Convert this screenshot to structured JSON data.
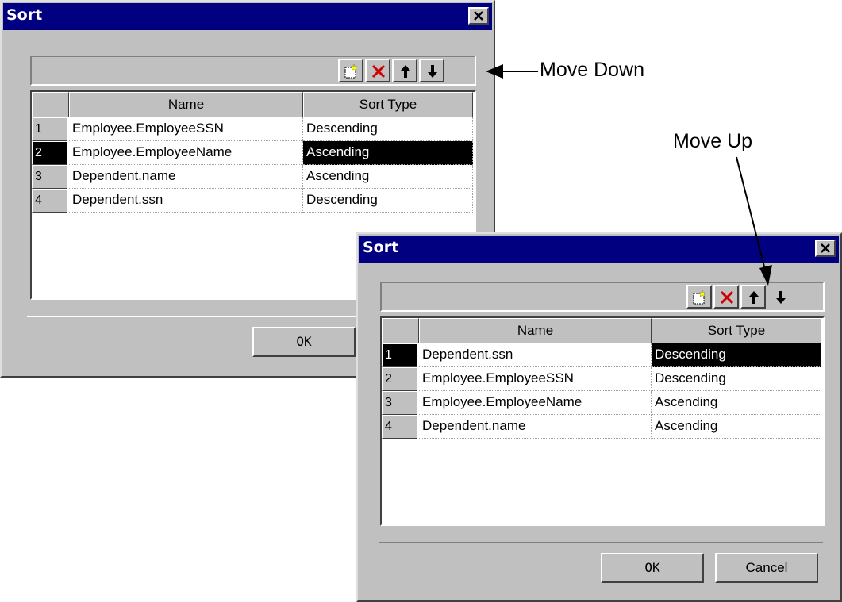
{
  "dialog1": {
    "title": "Sort",
    "columns": [
      "Name",
      "Sort Type"
    ],
    "rows": [
      {
        "num": "1",
        "name": "Employee.EmployeeSSN",
        "type": "Descending"
      },
      {
        "num": "2",
        "name": "Employee.EmployeeName",
        "type": "Ascending"
      },
      {
        "num": "3",
        "name": "Dependent.name",
        "type": "Ascending"
      },
      {
        "num": "4",
        "name": "Dependent.ssn",
        "type": "Descending"
      }
    ],
    "ok_label": "OK"
  },
  "dialog2": {
    "title": "Sort",
    "columns": [
      "Name",
      "Sort Type"
    ],
    "rows": [
      {
        "num": "1",
        "name": "Dependent.ssn",
        "type": "Descending"
      },
      {
        "num": "2",
        "name": "Employee.EmployeeSSN",
        "type": "Descending"
      },
      {
        "num": "3",
        "name": "Employee.EmployeeName",
        "type": "Ascending"
      },
      {
        "num": "4",
        "name": "Dependent.name",
        "type": "Ascending"
      }
    ],
    "ok_label": "OK",
    "cancel_label": "Cancel"
  },
  "annotations": {
    "move_down": "Move Down",
    "move_up": "Move Up"
  },
  "icons": {
    "toolbar": [
      "new-icon",
      "delete-icon",
      "arrow-up-icon",
      "arrow-down-icon"
    ],
    "close": "close-icon"
  },
  "colors": {
    "titlebar": "#000080",
    "face": "#c0c0c0",
    "selection": "#000000",
    "delete": "#d00000"
  }
}
